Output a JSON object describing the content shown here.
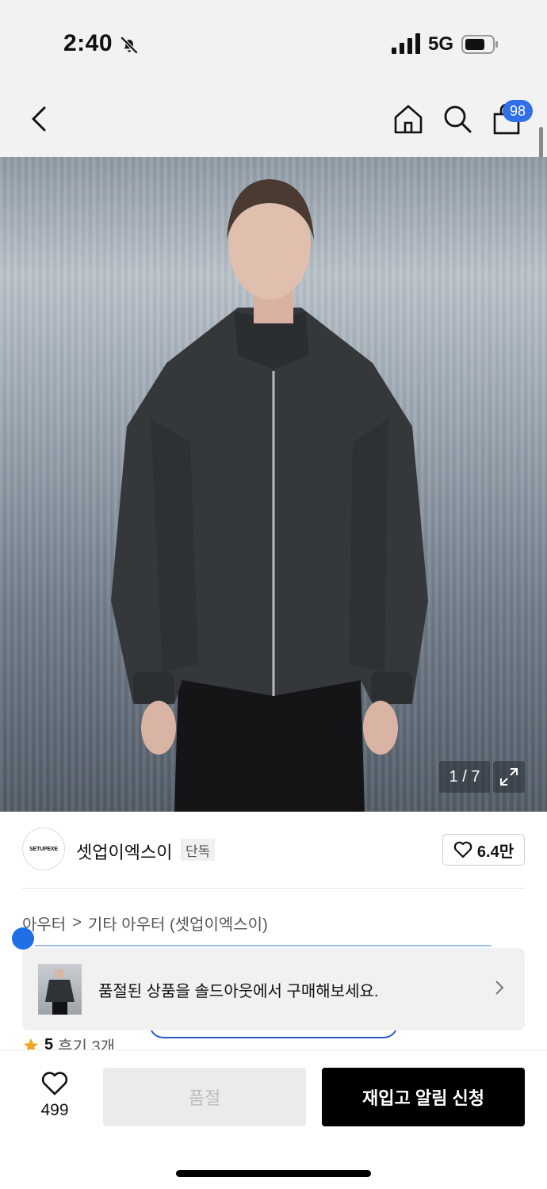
{
  "status_bar": {
    "time": "2:40",
    "network": "5G",
    "icons": [
      "bell-slash-icon",
      "signal-icon",
      "battery-icon"
    ]
  },
  "nav": {
    "icons": [
      "back-chevron-icon",
      "home-icon",
      "search-icon",
      "shopping-bag-icon"
    ],
    "cart_count": "98"
  },
  "gallery": {
    "counter": "1 / 7",
    "icons": [
      "expand-icon"
    ]
  },
  "brand": {
    "logo_text": "SETUPEXE",
    "name": "셋업이엑스이",
    "badge": "단독",
    "like_count": "6.4만"
  },
  "breadcrumb": {
    "category": "아우터",
    "separator": ">",
    "subcategory": "기타 아우터 (셋업이엑스이)"
  },
  "soldout_banner": {
    "message": "품절된 상품을 솔드아웃에서 구매해보세요."
  },
  "rating": {
    "value": "5",
    "reviews": "후기 3개"
  },
  "bottom_bar": {
    "wish_count": "499",
    "soldout_label": "품절",
    "restock_label": "재입고 알림 신청"
  },
  "colors": {
    "accent_blue": "#2f6fe8",
    "primary_button": "#000000",
    "disabled_button": "#ebebeb",
    "star": "#f5a623"
  }
}
